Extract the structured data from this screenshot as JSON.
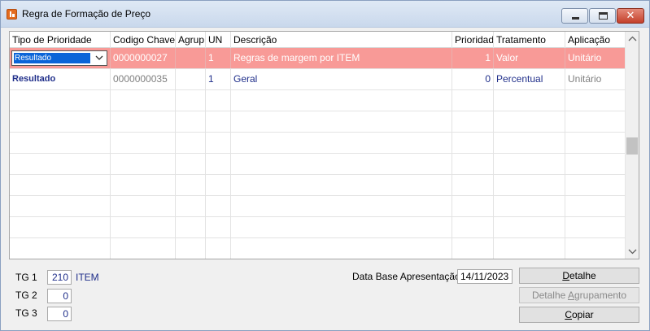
{
  "window": {
    "title": "Regra de Formação de Preço"
  },
  "grid": {
    "columns": [
      "Tipo de Prioridade",
      "Codigo Chave",
      "Agrup.",
      "UN",
      "Descrição",
      "Prioridade",
      "Tratamento",
      "Aplicação"
    ],
    "rows": [
      {
        "tipo": "Resultado",
        "codigo": "0000000027",
        "agrup": "",
        "un": "1",
        "descricao": "Regras de margem por ITEM",
        "prioridade": "1",
        "tratamento": "Valor",
        "aplicacao": "Unitário"
      },
      {
        "tipo": "Resultado",
        "codigo": "0000000035",
        "agrup": "",
        "un": "1",
        "descricao": "Geral",
        "prioridade": "0",
        "tratamento": "Percentual",
        "aplicacao": "Unitário"
      }
    ]
  },
  "footer": {
    "tg1_label": "TG 1",
    "tg1_value": "210",
    "tg1_desc": "ITEM",
    "tg2_label": "TG 2",
    "tg2_value": "0",
    "tg3_label": "TG 3",
    "tg3_value": "0",
    "data_base_label": "Data Base Apresentação",
    "data_base_value": "14/11/2023"
  },
  "buttons": {
    "detalhe_pre": "",
    "detalhe_u": "D",
    "detalhe_post": "etalhe",
    "agrup_pre": "Detalhe ",
    "agrup_u": "A",
    "agrup_post": "grupamento",
    "copiar_pre": "",
    "copiar_u": "C",
    "copiar_post": "opiar"
  },
  "colors": {
    "selected_row": "#f89a97",
    "text_blue": "#1f2e8a"
  }
}
